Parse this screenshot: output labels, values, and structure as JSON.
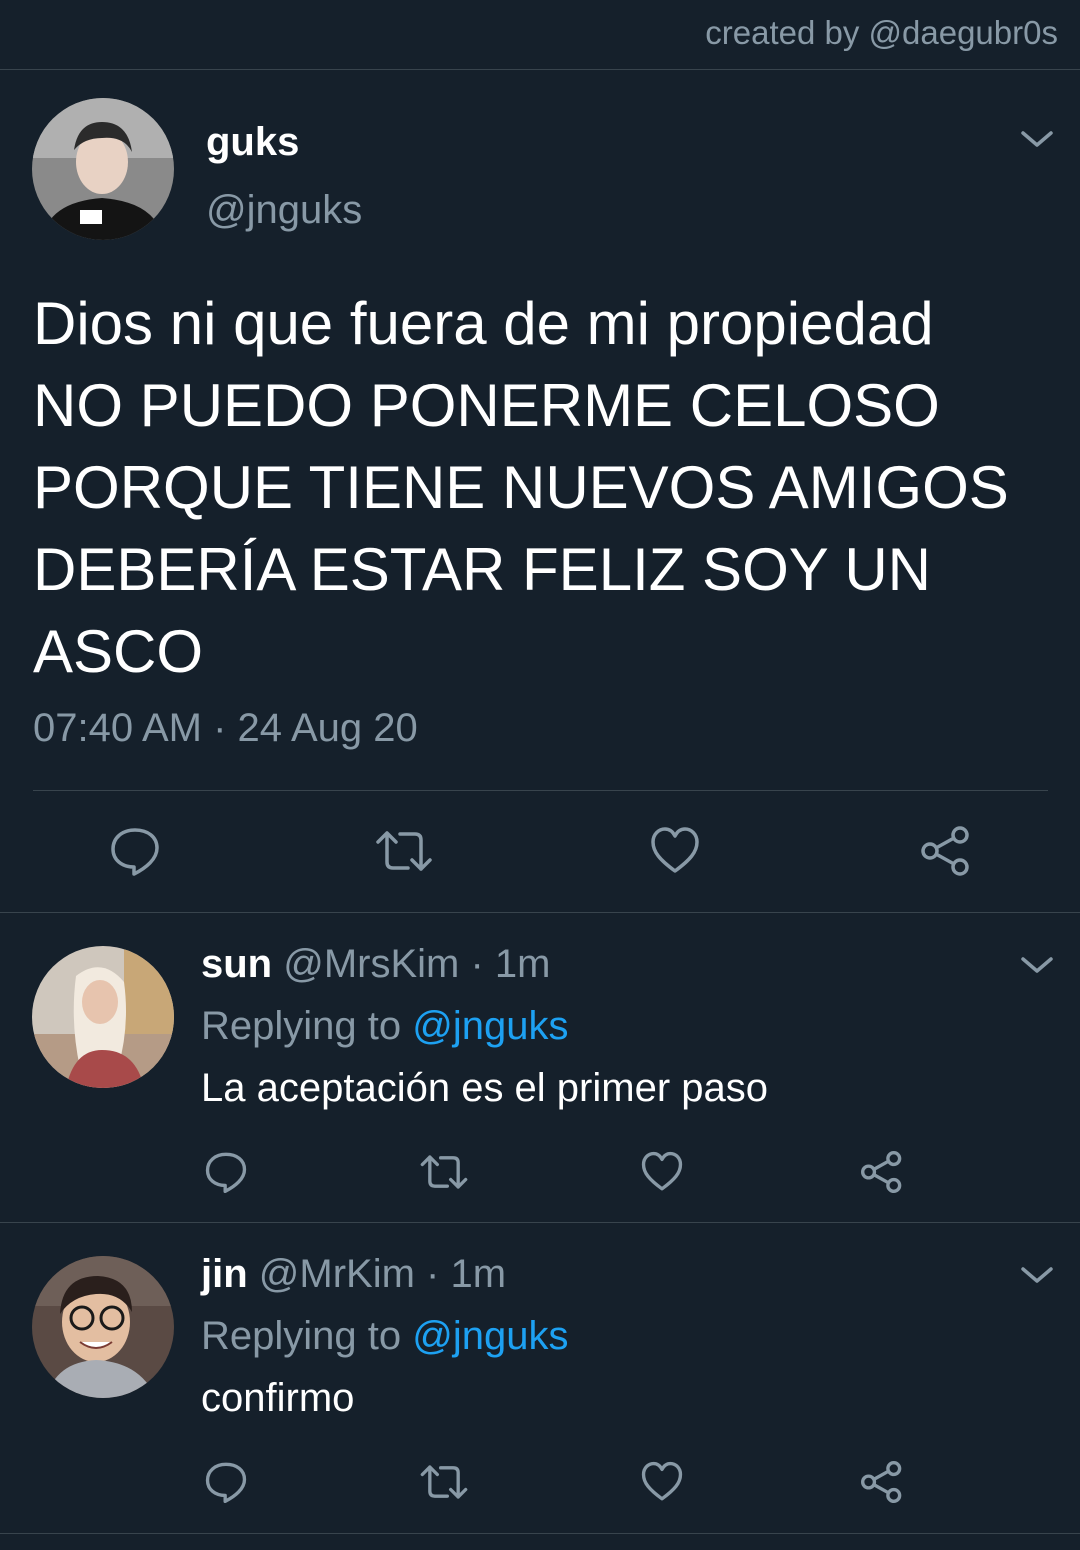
{
  "credit": "created by @daegubr0s",
  "colors": {
    "background": "#15202b",
    "secondary_text": "#8899a6",
    "link": "#1da1f2",
    "divider": "#38444d"
  },
  "main_tweet": {
    "name": "guks",
    "handle": "@jnguks",
    "text": "Dios ni que fuera de mi propiedad\nNO PUEDO PONERME CELOSO\nPORQUE TIENE NUEVOS AMIGOS\nDEBERÍA ESTAR FELIZ SOY UN\nASCO",
    "timestamp": "07:40 AM · 24 Aug 20",
    "actions": [
      "reply-icon",
      "retweet-icon",
      "like-icon",
      "share-icon"
    ]
  },
  "replies": [
    {
      "name": "sun",
      "meta": " @MrsKim · 1m",
      "replying_label": "Replying to ",
      "replying_to": "@jnguks",
      "text": "La aceptación es el primer paso"
    },
    {
      "name": "jin",
      "meta": " @MrKim · 1m",
      "replying_label": "Replying to ",
      "replying_to": "@jnguks",
      "text": "confirmo"
    }
  ]
}
